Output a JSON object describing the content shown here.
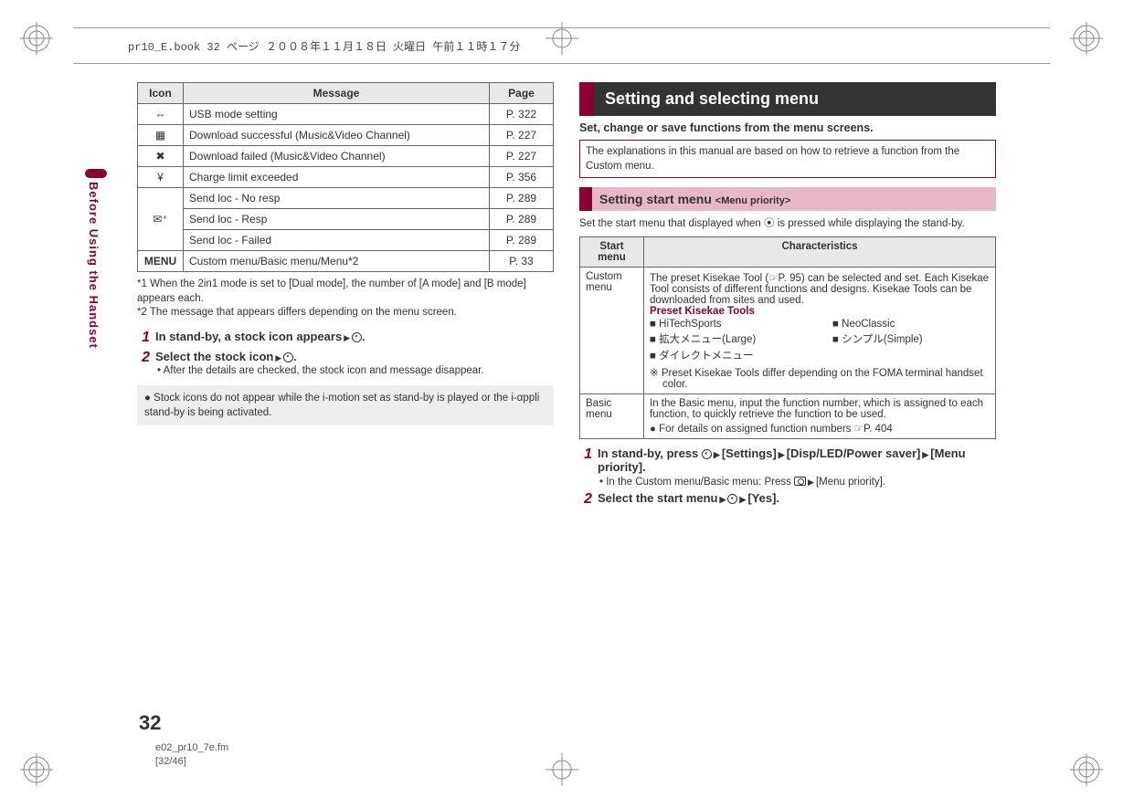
{
  "meta": {
    "top_filename": "pr10_E.book  32 ページ  ２００８年１１月１８日  火曜日  午前１１時１７分",
    "page_number": "32",
    "footer_file": "e02_pr10_7e.fm",
    "footer_sub": "[32/46]",
    "side_label": "Before Using the Handset"
  },
  "icon_table": {
    "headers": {
      "icon": "Icon",
      "message": "Message",
      "page": "Page"
    },
    "rows": [
      {
        "icon": "⇔",
        "message": "USB mode setting",
        "page": "P. 322"
      },
      {
        "icon": "▦",
        "message": "Download successful (Music&Video Channel)",
        "page": "P. 227"
      },
      {
        "icon": "✖",
        "message": "Download failed (Music&Video Channel)",
        "page": "P. 227"
      },
      {
        "icon": "¥",
        "message": "Charge limit exceeded",
        "page": "P. 356"
      },
      {
        "icon": "✉⁺",
        "message": "Send loc - No resp",
        "page": "P. 289",
        "rowspan_start": true
      },
      {
        "icon": "",
        "message": "Send loc - Resp",
        "page": "P. 289"
      },
      {
        "icon": "",
        "message": "Send loc - Failed",
        "page": "P. 289"
      },
      {
        "icon": "MENU",
        "message": "Custom menu/Basic menu/Menu*2",
        "page": "P. 33",
        "bold_icon": true
      }
    ]
  },
  "footnotes": {
    "f1": "*1  When the 2in1 mode is set to [Dual mode], the number of [A mode] and [B mode] appears each.",
    "f2": "*2  The message that appears differs depending on the menu screen."
  },
  "steps_left": {
    "s1": {
      "title": "In stand-by, a stock icon appears",
      "tail": "."
    },
    "s2": {
      "title": "Select the stock icon",
      "tail": ".",
      "sub": "• After the details are checked, the stock icon and message disappear."
    }
  },
  "note_left": "Stock icons do not appear while the i-motion set as stand-by is played or the i-αppli stand-by is being activated.",
  "section": {
    "title": "Setting and selecting menu",
    "subtitle": "Set, change or save functions from the menu screens.",
    "info": "The explanations in this manual are based on how to retrieve a function from the Custom menu."
  },
  "subsection": {
    "title": "Setting start menu ",
    "tag": "<Menu priority>",
    "body": "Set the start menu that displayed when ⦿ is pressed while displaying the stand-by."
  },
  "char_table": {
    "headers": {
      "sm": "Start menu",
      "ch": "Characteristics"
    },
    "custom": {
      "name": "Custom menu",
      "desc": "The preset Kisekae Tool (☞P. 95) can be selected and set. Each Kisekae Tool consists of different functions and designs. Kisekae Tools can be downloaded from sites and used.",
      "preset_title": "Preset Kisekae Tools",
      "tools": [
        "HiTechSports",
        "NeoClassic",
        "拡大メニュー(Large)",
        "シンプル(Simple)",
        "ダイレクトメニュー"
      ],
      "note": "※ Preset Kisekae Tools differ depending on the FOMA terminal handset color."
    },
    "basic": {
      "name": "Basic menu",
      "desc": "In the Basic menu, input the function number, which is assigned to each function, to quickly retrieve the function to be used.",
      "sub": "For details on assigned function numbers ☞P. 404"
    }
  },
  "steps_right": {
    "s1": {
      "line1": "In stand-by, press ",
      "seg2": "[Settings]",
      "seg3": "[Disp/LED/Power saver]",
      "seg4": "[Menu priority].",
      "sub": "• In the Custom menu/Basic menu: Press ",
      "sub_tail": "[Menu priority]."
    },
    "s2": {
      "title": "Select the start menu",
      "tail": "[Yes]."
    }
  }
}
